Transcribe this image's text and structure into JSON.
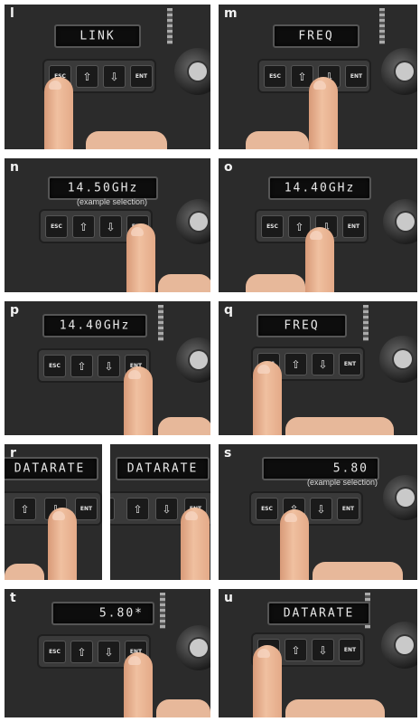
{
  "panels": [
    {
      "id": "l",
      "letter": "l",
      "display": "LINK",
      "note": "",
      "pressed": "esc"
    },
    {
      "id": "m",
      "letter": "m",
      "display": "FREQ",
      "note": "",
      "pressed": "down"
    },
    {
      "id": "n",
      "letter": "n",
      "display": "14.50GHz",
      "note": "(example selection)",
      "pressed": "ent"
    },
    {
      "id": "o",
      "letter": "o",
      "display": "14.40GHz",
      "note": "",
      "pressed": "down"
    },
    {
      "id": "p",
      "letter": "p",
      "display": "14.40GHz",
      "note": "",
      "pressed": "ent"
    },
    {
      "id": "q",
      "letter": "q",
      "display": "FREQ",
      "note": "",
      "pressed": "esc"
    },
    {
      "id": "r1",
      "letter": "r",
      "display": "DATARATE",
      "note": "",
      "pressed": "down"
    },
    {
      "id": "r2",
      "letter": "",
      "display": "DATARATE",
      "note": "",
      "pressed": "ent"
    },
    {
      "id": "s",
      "letter": "s",
      "display": "5.80",
      "note": "(example selection)",
      "pressed": "up"
    },
    {
      "id": "t",
      "letter": "t",
      "display": "5.80*",
      "note": "",
      "pressed": "ent"
    },
    {
      "id": "u",
      "letter": "u",
      "display": "DATARATE",
      "note": "",
      "pressed": "esc"
    }
  ],
  "keys": {
    "esc": "ESC",
    "up": "⇧",
    "down": "⇩",
    "ent": "ENT"
  },
  "colors": {
    "device": "#2b2b2b",
    "lcd": "#0d0d0d",
    "skin": "#f0c0a0",
    "key": "#1a1a1a"
  }
}
